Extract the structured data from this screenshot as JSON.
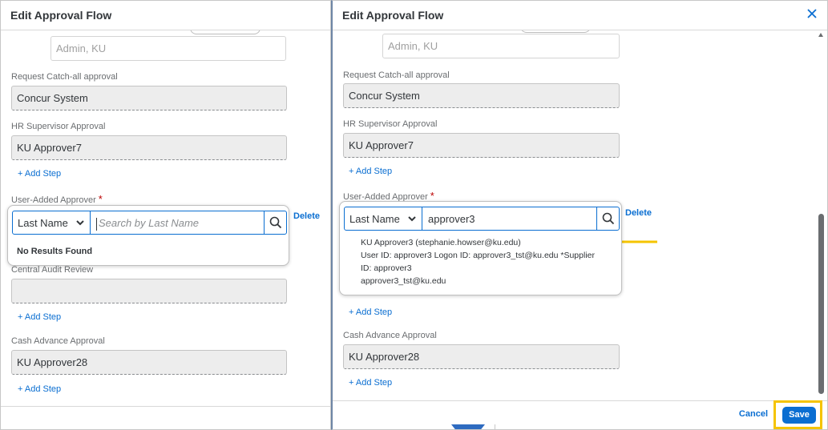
{
  "left_dialog": {
    "title": "Edit Approval Flow",
    "cut_value": "Admin, KU",
    "steps": [
      {
        "label": "Request Catch-all approval",
        "value": "Concur System"
      },
      {
        "label": "HR Supervisor Approval",
        "value": "KU Approver7"
      },
      {
        "label": "Central Audit Review",
        "value": ""
      },
      {
        "label": "Cash Advance Approval",
        "value": "KU Approver28"
      }
    ],
    "add_step_label": "+ Add Step",
    "user_added_label": "User-Added Approver",
    "required_marker": "*",
    "delete_label": "Delete",
    "search": {
      "select_value": "Last Name",
      "placeholder": "Search by Last Name",
      "value": "",
      "no_results": "No Results Found"
    }
  },
  "right_dialog": {
    "title": "Edit Approval Flow",
    "cut_value": "Admin, KU",
    "steps": [
      {
        "label": "Request Catch-all approval",
        "value": "Concur System"
      },
      {
        "label": "HR Supervisor Approval",
        "value": "KU Approver7"
      },
      {
        "label": "Cash Advance Approval",
        "value": "KU Approver28"
      }
    ],
    "add_step_label": "+ Add Step",
    "user_added_label": "User-Added Approver",
    "required_marker": "*",
    "delete_label": "Delete",
    "search": {
      "select_value": "Last Name",
      "value": "approver3"
    },
    "result": {
      "line1": "KU Approver3 (stephanie.howser@ku.edu)",
      "line2": "User ID: approver3 Logon ID: approver3_tst@ku.edu *Supplier",
      "line3": "ID: approver3",
      "line4": "approver3_tst@ku.edu"
    },
    "footer": {
      "cancel_label": "Cancel",
      "save_label": "Save"
    }
  },
  "colors": {
    "link_blue": "#0a6ed1",
    "highlight_yellow": "#f5c400",
    "required_red": "#bb0000",
    "arrow_yellow": "#f5c400"
  },
  "icons": [
    "close-icon",
    "chevron-down-icon",
    "search-icon",
    "arrow-left-icon",
    "scroll-up-icon"
  ]
}
